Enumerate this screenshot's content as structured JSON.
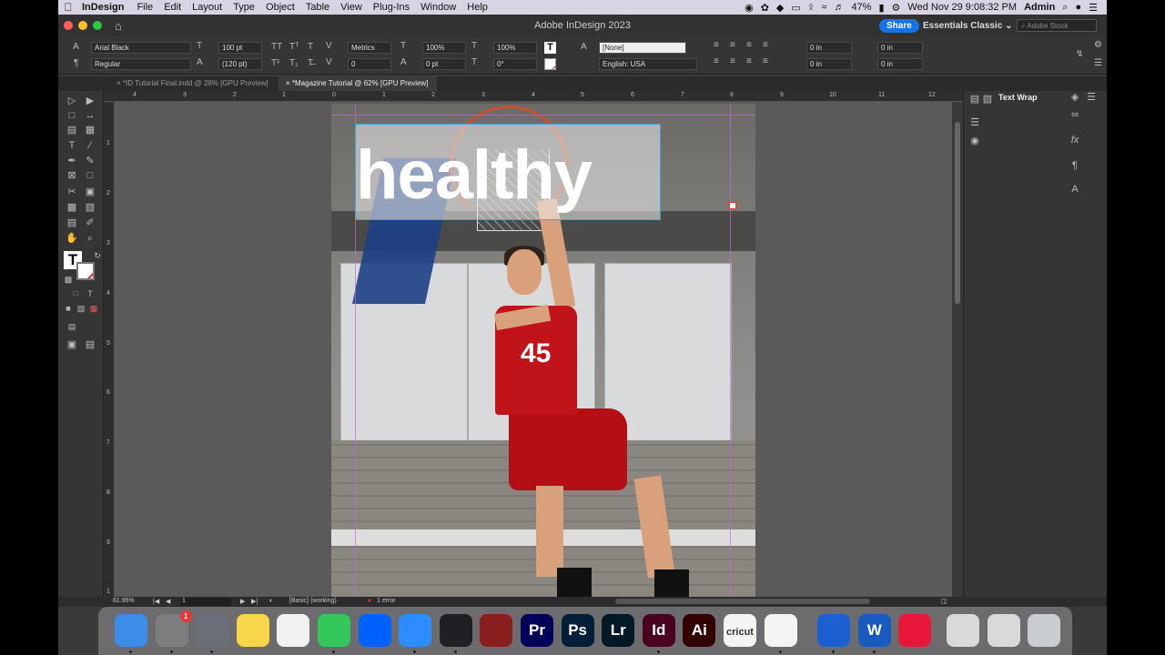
{
  "menubar": {
    "app_name": "InDesign",
    "menus": [
      "File",
      "Edit",
      "Layout",
      "Type",
      "Object",
      "Table",
      "View",
      "Plug-Ins",
      "Window",
      "Help"
    ],
    "battery": "47%",
    "clock": "Wed Nov 29  9:08:32 PM",
    "user": "Admin"
  },
  "titlebar": {
    "title": "Adobe InDesign 2023",
    "share_label": "Share",
    "workspace": "Essentials Classic",
    "stock_placeholder": "Adobe Stock"
  },
  "control": {
    "font_family": "Arial Black",
    "font_style": "Regular",
    "font_size": "100 pt",
    "leading": "(120 pt)",
    "kerning": "Metrics",
    "tracking": "0",
    "vscale": "100%",
    "baseline": "0 pt",
    "hscale": "100%",
    "skew": "0°",
    "char_style": "[None]",
    "language": "English: USA",
    "indent_left": "0 in",
    "indent_first": "0 in",
    "indent_right": "0 in",
    "indent_last": "0 in"
  },
  "tabs": [
    {
      "label": "*ID Tutorial Final.indd @ 28% [GPU Preview]",
      "active": false
    },
    {
      "label": "*Magazine Tutorial @ 62% [GPU Preview]",
      "active": true
    }
  ],
  "ruler": {
    "h_ticks": [
      "4",
      "3",
      "2",
      "1",
      "0",
      "1",
      "2",
      "3",
      "4",
      "5",
      "6",
      "7",
      "8",
      "9",
      "10",
      "11",
      "12"
    ],
    "v_ticks": [
      "1",
      "2",
      "3",
      "4",
      "5",
      "6",
      "7",
      "8",
      "9",
      "1"
    ]
  },
  "document": {
    "headline": "healthy",
    "jersey_number": "45"
  },
  "right_panel": {
    "label": "Text Wrap"
  },
  "statusbar": {
    "zoom": "61.95%",
    "page": "1",
    "preflight_profile": "[Basic] (working)",
    "errors": "1 error"
  },
  "dock": {
    "apps": [
      {
        "name": "Finder",
        "label": "",
        "color": "#3c8ce8"
      },
      {
        "name": "System Preferences",
        "label": "",
        "color": "#7d7d80",
        "badge": "1"
      },
      {
        "name": "Launchpad",
        "label": "",
        "color": "#6a6f7a"
      },
      {
        "name": "Notes",
        "label": "",
        "color": "#f7d64a"
      },
      {
        "name": "Photos",
        "label": "",
        "color": "#f2f2f2"
      },
      {
        "name": "Messages",
        "label": "",
        "color": "#34c759"
      },
      {
        "name": "Dropbox",
        "label": "",
        "color": "#0061fe"
      },
      {
        "name": "Zoom",
        "label": "",
        "color": "#2d8cff"
      },
      {
        "name": "QuickTime",
        "label": "",
        "color": "#1f1f24"
      },
      {
        "name": "Photo Booth",
        "label": "",
        "color": "#8a1d1d"
      },
      {
        "name": "Premiere Pro",
        "label": "Pr",
        "color": "#00005b"
      },
      {
        "name": "Photoshop",
        "label": "Ps",
        "color": "#001e36"
      },
      {
        "name": "Lightroom",
        "label": "Lr",
        "color": "#001a25"
      },
      {
        "name": "InDesign",
        "label": "Id",
        "color": "#49021f"
      },
      {
        "name": "Illustrator",
        "label": "Ai",
        "color": "#330000"
      },
      {
        "name": "Cricut",
        "label": "cricut",
        "color": "#f4f4f4"
      },
      {
        "name": "Chrome",
        "label": "",
        "color": "#f4f4f4"
      },
      {
        "name": "Bluetooth",
        "label": "",
        "color": "#1b5fd0"
      },
      {
        "name": "Word",
        "label": "W",
        "color": "#185abd"
      },
      {
        "name": "Creative Cloud",
        "label": "",
        "color": "#e8173a"
      },
      {
        "name": "Recent 1",
        "label": "",
        "color": "#d9d9d9"
      },
      {
        "name": "Recent 2",
        "label": "",
        "color": "#d9d9d9"
      },
      {
        "name": "Trash",
        "label": "",
        "color": "#c9cdd2"
      }
    ]
  },
  "colors": {
    "accent": "#1473e6",
    "jersey_red": "#c0141a",
    "frame_selection": "#3aa3d9"
  }
}
